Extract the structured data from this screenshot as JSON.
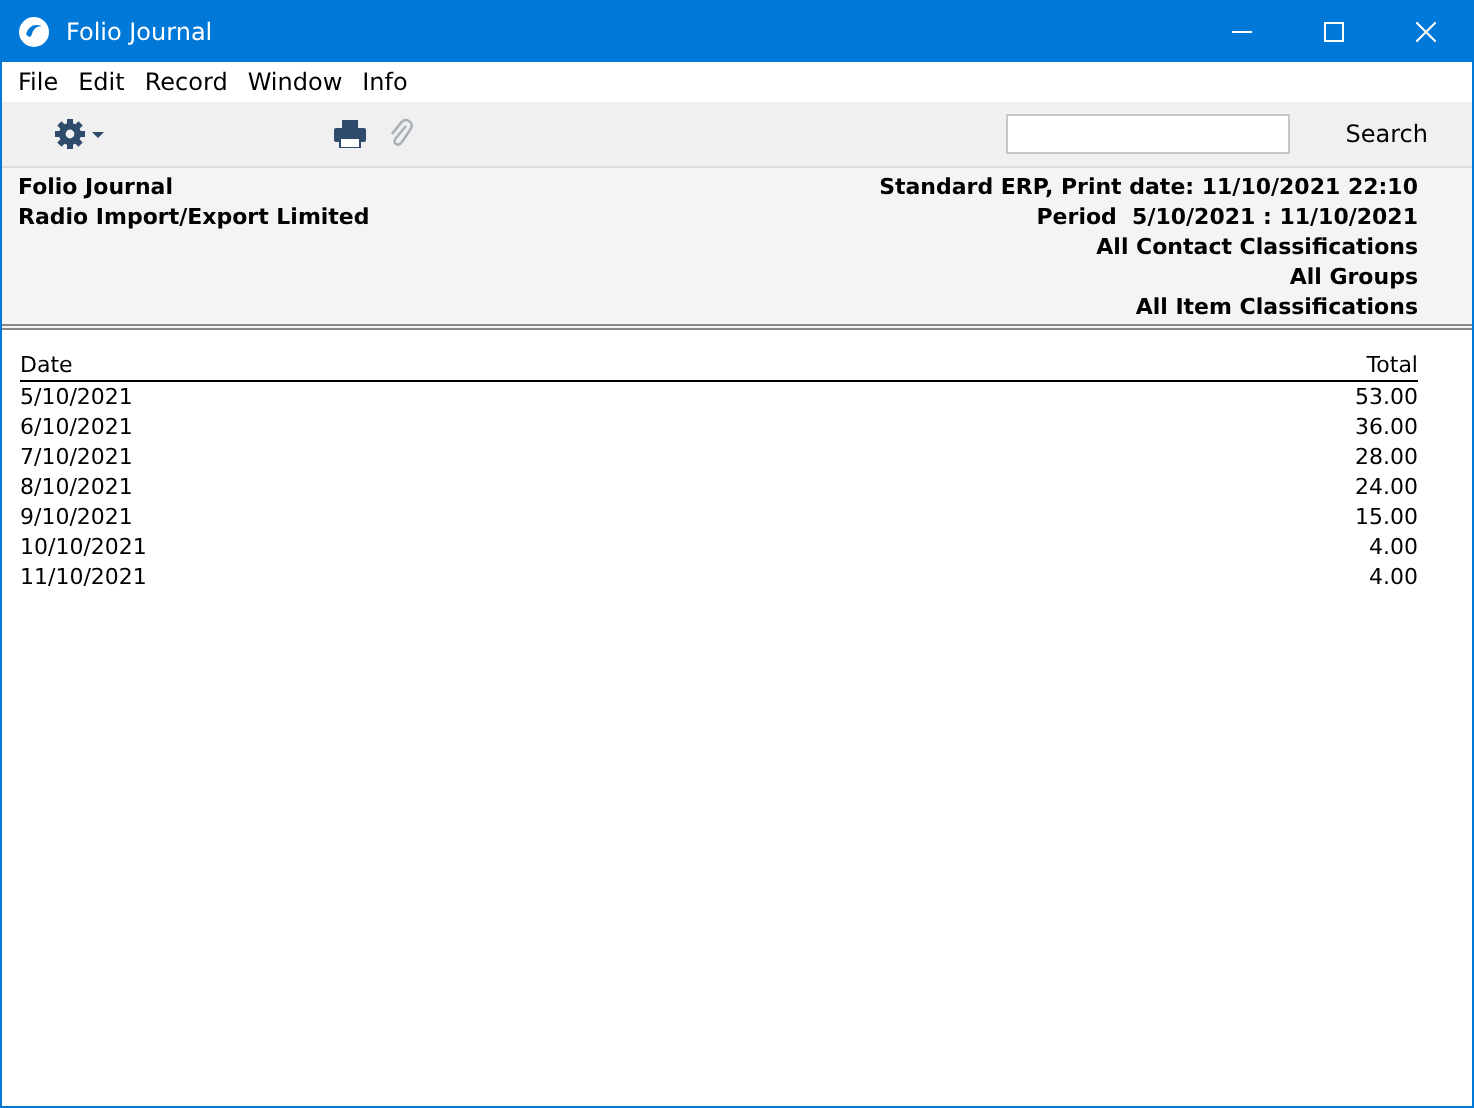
{
  "window": {
    "title": "Folio Journal"
  },
  "menu": [
    "File",
    "Edit",
    "Record",
    "Window",
    "Info"
  ],
  "toolbar": {
    "attach": {
      "disabled": true
    },
    "search": {
      "button": "Search"
    }
  },
  "report_header": {
    "left": [
      "Folio Journal",
      "Radio Import/Export Limited"
    ],
    "right": [
      "Standard ERP, Print date: 11/10/2021 22:10",
      "Period  5/10/2021 : 11/10/2021",
      "All Contact Classifications",
      "All Groups",
      "All Item Classifications"
    ]
  },
  "table": {
    "columns": [
      "Date",
      "Total"
    ],
    "rows": [
      [
        "5/10/2021",
        "53.00"
      ],
      [
        "6/10/2021",
        "36.00"
      ],
      [
        "7/10/2021",
        "28.00"
      ],
      [
        "8/10/2021",
        "24.00"
      ],
      [
        "9/10/2021",
        "15.00"
      ],
      [
        "10/10/2021",
        "4.00"
      ],
      [
        "11/10/2021",
        "4.00"
      ]
    ]
  }
}
